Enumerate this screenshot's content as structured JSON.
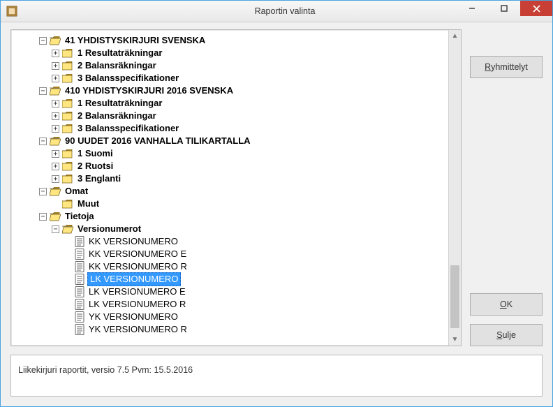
{
  "window": {
    "title": "Raportin valinta"
  },
  "buttons": {
    "groupings": "Ryhmittelyt",
    "groupings_u": "R",
    "ok": "OK",
    "ok_u": "O",
    "close": "Sulje",
    "close_u": "S"
  },
  "status": "Liikekirjuri raportit, versio 7.5  Pvm: 15.5.2016",
  "tree": [
    {
      "level": 0,
      "exp": "-",
      "icon": "folder-open",
      "label": "41 YHDISTYSKIRJURI SVENSKA",
      "bold": true
    },
    {
      "level": 1,
      "exp": "+",
      "icon": "folder",
      "label": "1 Resultaträkningar",
      "bold": true
    },
    {
      "level": 1,
      "exp": "+",
      "icon": "folder",
      "label": "2 Balansräkningar",
      "bold": true
    },
    {
      "level": 1,
      "exp": "+",
      "icon": "folder",
      "label": "3 Balansspecifikationer",
      "bold": true
    },
    {
      "level": 0,
      "exp": "-",
      "icon": "folder-open",
      "label": "410 YHDISTYSKIRJURI 2016 SVENSKA",
      "bold": true
    },
    {
      "level": 1,
      "exp": "+",
      "icon": "folder",
      "label": "1 Resultaträkningar",
      "bold": true
    },
    {
      "level": 1,
      "exp": "+",
      "icon": "folder",
      "label": "2 Balansräkningar",
      "bold": true
    },
    {
      "level": 1,
      "exp": "+",
      "icon": "folder",
      "label": "3 Balansspecifikationer",
      "bold": true
    },
    {
      "level": 0,
      "exp": "-",
      "icon": "folder-open",
      "label": "90 UUDET 2016 VANHALLA TILIKARTALLA",
      "bold": true
    },
    {
      "level": 1,
      "exp": "+",
      "icon": "folder",
      "label": "1 Suomi",
      "bold": true
    },
    {
      "level": 1,
      "exp": "+",
      "icon": "folder",
      "label": "2 Ruotsi",
      "bold": true
    },
    {
      "level": 1,
      "exp": "+",
      "icon": "folder",
      "label": "3 Englanti",
      "bold": true
    },
    {
      "level": 0,
      "exp": "-",
      "icon": "folder-open",
      "label": "Omat",
      "bold": true
    },
    {
      "level": 1,
      "exp": "",
      "icon": "folder",
      "label": "Muut",
      "bold": true
    },
    {
      "level": 0,
      "exp": "-",
      "icon": "folder-open",
      "label": "Tietoja",
      "bold": true
    },
    {
      "level": 1,
      "exp": "-",
      "icon": "folder-open",
      "label": "Versionumerot",
      "bold": true
    },
    {
      "level": 2,
      "exp": "",
      "icon": "report",
      "label": "KK VERSIONUMERO"
    },
    {
      "level": 2,
      "exp": "",
      "icon": "report",
      "label": "KK VERSIONUMERO E"
    },
    {
      "level": 2,
      "exp": "",
      "icon": "report",
      "label": "KK VERSIONUMERO R"
    },
    {
      "level": 2,
      "exp": "",
      "icon": "report",
      "label": "LK VERSIONUMERO",
      "selected": true
    },
    {
      "level": 2,
      "exp": "",
      "icon": "report",
      "label": "LK VERSIONUMERO E"
    },
    {
      "level": 2,
      "exp": "",
      "icon": "report",
      "label": "LK VERSIONUMERO R"
    },
    {
      "level": 2,
      "exp": "",
      "icon": "report",
      "label": "YK VERSIONUMERO"
    },
    {
      "level": 2,
      "exp": "",
      "icon": "report",
      "label": "YK VERSIONUMERO R"
    }
  ]
}
